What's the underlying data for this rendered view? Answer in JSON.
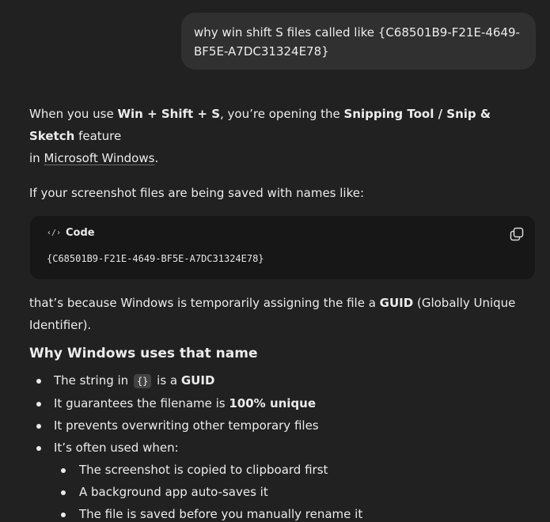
{
  "user_message": {
    "line1": "why win shift S files called like {C68501B9-F21E-4649-",
    "line2": "BF5E-A7DC31324E78}"
  },
  "assistant": {
    "p1": {
      "t1": "When you use ",
      "b1": "Win + Shift + S",
      "t2": ", you’re opening the ",
      "b2": "Snipping Tool / Snip & Sketch",
      "t3": " feature",
      "t4": "in ",
      "link": "Microsoft Windows",
      "t5": "."
    },
    "p2": "If your screenshot files are being saved with names like:",
    "code_block": {
      "icon": "code-icon",
      "language_label": "Code",
      "copy_icon": "copy-icon",
      "content": "{C68501B9-F21E-4649-BF5E-A7DC31324E78}"
    },
    "p3": {
      "t1": "that’s because Windows is temporarily assigning the file a ",
      "b1": "GUID",
      "t2": " (Globally Unique",
      "t3": "Identifier)."
    },
    "heading": "Why Windows uses that name",
    "bullets": {
      "b1_pre": "The string in ",
      "b1_code": "{}",
      "b1_mid": " is a ",
      "b1_bold": "GUID",
      "b2_pre": "It guarantees the filename is ",
      "b2_bold": "100% unique",
      "b3": "It prevents overwriting other temporary files",
      "b4": "It’s often used when:",
      "sub": [
        "The screenshot is copied to clipboard first",
        "A background app auto-saves it",
        "The file is saved before you manually rename it"
      ]
    }
  }
}
